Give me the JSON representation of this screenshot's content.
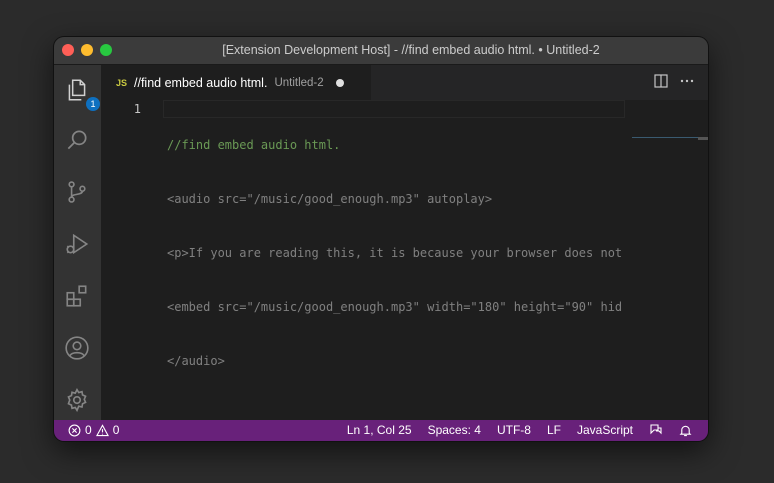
{
  "window": {
    "title": "[Extension Development Host] - //find embed audio html. • Untitled-2"
  },
  "activity_bar": {
    "explorer_badge": "1",
    "items": [
      "files-icon",
      "search-icon",
      "source-control-icon",
      "run-debug-icon",
      "extensions-icon",
      "account-icon",
      "gear-icon"
    ]
  },
  "tab": {
    "lang_badge": "JS",
    "title": "//find embed audio html.",
    "description": "Untitled-2"
  },
  "editor": {
    "line_numbers": [
      "1"
    ],
    "lines": [
      "//find embed audio html.",
      "<audio src=\"/music/good_enough.mp3\" autoplay>",
      "<p>If you are reading this, it is because your browser does not",
      "<embed src=\"/music/good_enough.mp3\" width=\"180\" height=\"90\" hid",
      "</audio>"
    ]
  },
  "status_bar": {
    "errors": "0",
    "warnings": "0",
    "position": "Ln 1, Col 25",
    "spaces": "Spaces: 4",
    "encoding": "UTF-8",
    "eol": "LF",
    "language": "JavaScript"
  },
  "colors": {
    "status_bar": "#68217a",
    "comment": "#6a9955",
    "badge": "#0e70c0"
  }
}
